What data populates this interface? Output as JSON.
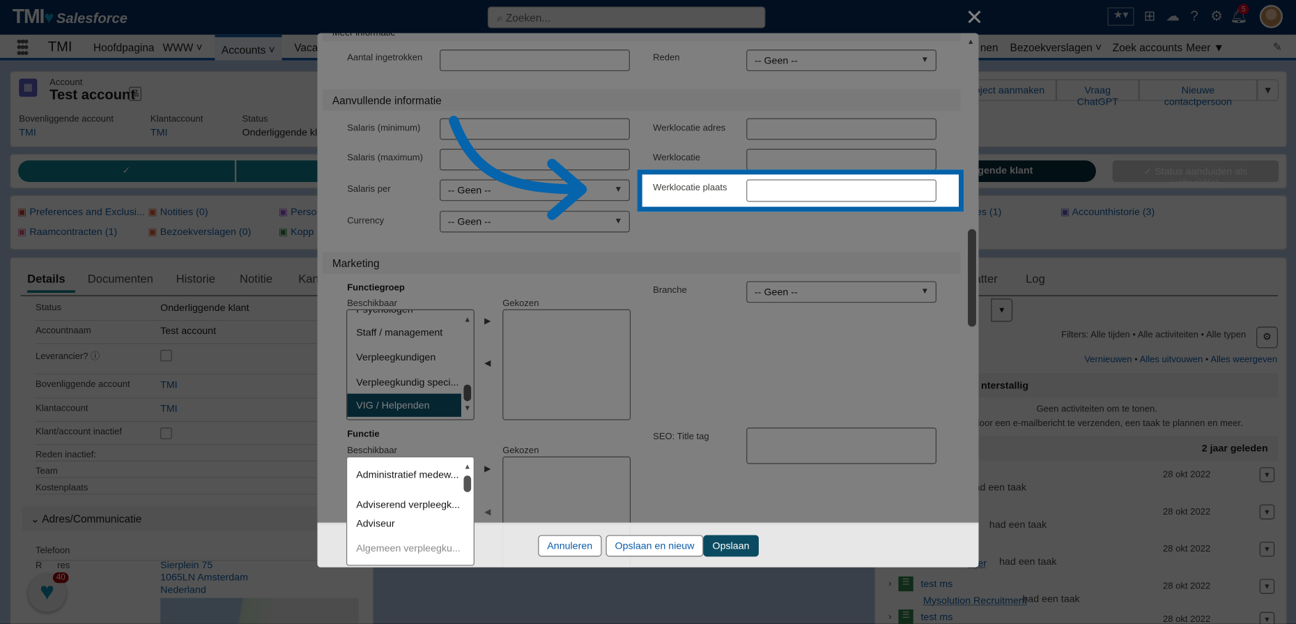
{
  "header": {
    "logo_text": "TMI",
    "logo_brand": "Salesforce",
    "search_placeholder": "Zoeken...",
    "notification_count": "5",
    "icons": [
      "star-icon",
      "caret-down-icon",
      "plus-icon",
      "cloud-icon",
      "help-icon",
      "gear-icon",
      "bell-icon",
      "avatar"
    ]
  },
  "nav": {
    "app_name": "TMI",
    "items": [
      "Hoofdpagina",
      "WWW",
      "Accounts",
      "Vacat",
      "nen",
      "Bezoekverslagen",
      "Zoek accounts",
      "Meer"
    ],
    "active": "Accounts"
  },
  "record": {
    "object": "Account",
    "name": "Test account",
    "fields": [
      {
        "label": "Bovenliggende account",
        "value": "TMI"
      },
      {
        "label": "Klantaccount",
        "value": "TMI"
      },
      {
        "label": "Status",
        "value": "Onderliggende kl"
      }
    ],
    "actions": [
      "roject aanmaken",
      "Vraag ChatGPT",
      "Nieuwe contactpersoon"
    ]
  },
  "path": {
    "current": "gende klant",
    "complete_button": "Status aanduiden als voltooid(e)"
  },
  "related": [
    "Preferences and Exclusi...",
    "Notities (0)",
    "Perso",
    "es (1)",
    "Accounthistorie (3)",
    "Raamcontracten (1)",
    "Bezoekverslagen (0)",
    "Kopp"
  ],
  "details": {
    "tabs": [
      "Details",
      "Documenten",
      "Historie",
      "Notitie",
      "Kan"
    ],
    "fields": [
      {
        "label": "Status",
        "value": "Onderliggende klant"
      },
      {
        "label": "Accountnaam",
        "value": "Test account"
      },
      {
        "label": "Leverancier?",
        "value": ""
      },
      {
        "label": "Bovenliggende account",
        "value": "TMI"
      },
      {
        "label": "Klantaccount",
        "value": "TMI"
      },
      {
        "label": "Klant/account inactief",
        "value": ""
      },
      {
        "label": "Reden inactief:",
        "value": ""
      },
      {
        "label": "Team",
        "value": ""
      },
      {
        "label": "Kostenplaats",
        "value": ""
      }
    ],
    "section": "Adres/Communicatie",
    "telefoon": "Telefoon",
    "address_label": "R      res",
    "address": [
      "Sierplein 75",
      "1065LN Amsterdam",
      "Nederland"
    ]
  },
  "widget": {
    "badge": "40"
  },
  "activity": {
    "tabs": [
      "atter",
      "Log"
    ],
    "filters": "Filters: Alle tijden • Alle activiteiten • Alle typen",
    "links": [
      "Vernieuwen",
      "Alles uitvouwen",
      "Alles weergeven"
    ],
    "overdue": "nterstallig",
    "empty1": "Geen activiteiten om te tonen.",
    "empty2": "door een e-mailbericht te verzenden, een taak te plannen en meer.",
    "group": "2 jaar geleden",
    "items": [
      {
        "title": "",
        "who": "",
        "text": "ad een taak",
        "date": "28 okt 2022"
      },
      {
        "title": "",
        "who": "",
        "text": "had een taak",
        "date": "28 okt 2022"
      },
      {
        "title": "",
        "who": "eijer",
        "text": "had een taak",
        "date": "28 okt 2022"
      },
      {
        "title": "test ms",
        "who": "Mysolution Recruitment",
        "text": "had een taak",
        "date": "28 okt 2022"
      },
      {
        "title": "test ms",
        "who": "",
        "text": "",
        "date": "28 okt 2022"
      }
    ]
  },
  "modal": {
    "top_section": "Meer informatie",
    "aantal_label": "Aantal ingetrokken",
    "aantal_value": "",
    "reden_label": "Reden",
    "reden_value": "-- Geen --",
    "section_aanvullend": "Aanvullende informatie",
    "salaris_min": "Salaris (minimum)",
    "salaris_max": "Salaris (maximum)",
    "salaris_per": "Salaris per",
    "salaris_per_value": "-- Geen --",
    "currency": "Currency",
    "currency_value": "-- Geen --",
    "werk_adres": "Werklocatie adres",
    "werk": "Werklocatie",
    "werk_plaats": "Werklocatie plaats",
    "werk_plaats_value": "",
    "section_marketing": "Marketing",
    "functiegroep": "Functiegroep",
    "beschikbaar": "Beschikbaar",
    "gekozen": "Gekozen",
    "functiegroep_options": [
      "Psychologen",
      "Staff / management",
      "Verpleegkundigen",
      "Verpleegkundig speci...",
      "VIG / Helpenden"
    ],
    "functiegroep_selected": "VIG / Helpenden",
    "branche": "Branche",
    "branche_value": "-- Geen --",
    "functie": "Functie",
    "functie_options": [
      "Administratief medew...",
      "Adviserend verpleegk...",
      "Adviseur",
      "Algemeen verpleegku..."
    ],
    "seo": "SEO: Title tag",
    "buttons": {
      "cancel": "Annuleren",
      "save_new": "Opslaan en nieuw",
      "save": "Opslaan"
    }
  },
  "highlight_color": "#0561a8"
}
